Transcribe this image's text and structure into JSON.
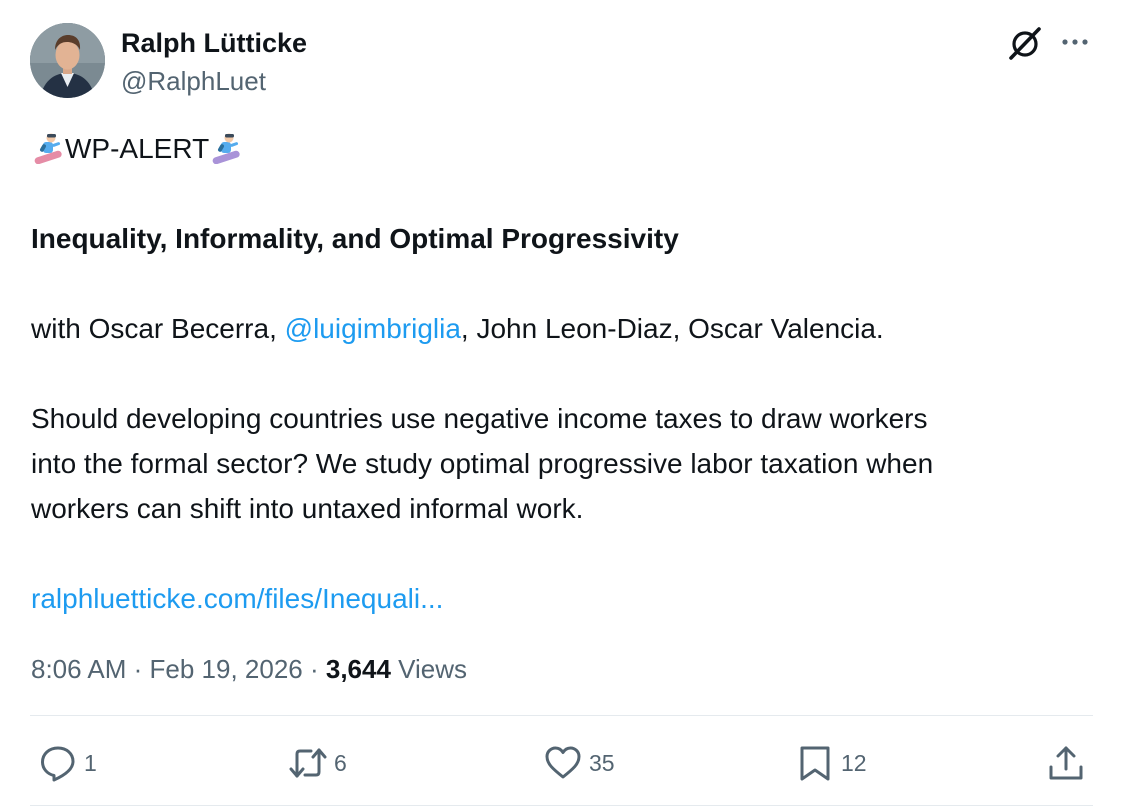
{
  "author": {
    "display_name": "Ralph Lütticke",
    "handle": "@RalphLuet"
  },
  "header_icons": [
    "grok-icon",
    "more-icon"
  ],
  "tweet": {
    "alert_text": "WP-ALERT",
    "alert_emoji": "snowboarder-emoji",
    "title": "Inequality, Informality, and Optimal Progressivity",
    "coauthors_prefix": "with Oscar Becerra, ",
    "coauthors_mention": "@luigimbriglia",
    "coauthors_suffix": ", John Leon-Diaz, Oscar Valencia.",
    "body_line_1": "Should developing countries use negative income taxes to draw workers",
    "body_line_2": "into the formal sector? We study optimal progressive labor taxation when",
    "body_line_3": "workers can shift into untaxed informal work.",
    "link": "ralphluetticke.com/files/Inequali..."
  },
  "meta": {
    "time": "8:06 AM",
    "separator": " · ",
    "date": "Feb 19, 2026",
    "views_count": "3,644",
    "views_label": " Views"
  },
  "actions": {
    "reply": {
      "icon": "reply-icon",
      "count": "1"
    },
    "retweet": {
      "icon": "retweet-icon",
      "count": "6"
    },
    "like": {
      "icon": "heart-icon",
      "count": "35"
    },
    "bookmark": {
      "icon": "bookmark-icon",
      "count": "12"
    },
    "share": {
      "icon": "share-icon"
    }
  },
  "colors": {
    "text": "#0f1419",
    "secondary_text": "#536471",
    "link": "#1d9bf0",
    "divider": "#e5eaee"
  }
}
